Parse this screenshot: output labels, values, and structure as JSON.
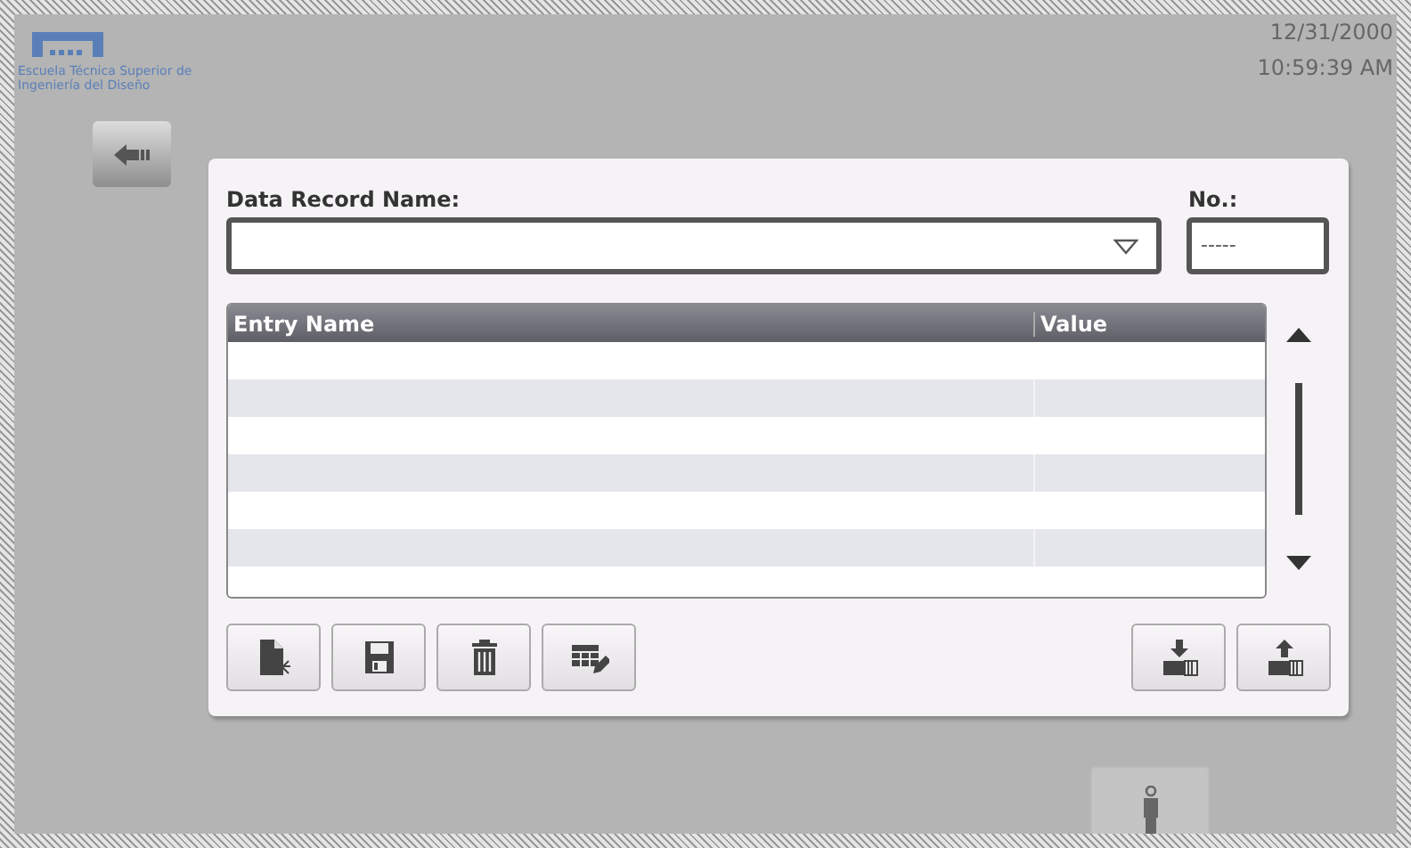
{
  "logo": {
    "caption": "Escuela Técnica Superior de Ingeniería del Diseño"
  },
  "clock": {
    "date": "12/31/2000",
    "time": "10:59:39 AM"
  },
  "recipe": {
    "name_label": "Data Record Name:",
    "number_label": "No.:",
    "number_value": "-----",
    "table": {
      "columns": [
        "Entry Name",
        "Value"
      ]
    }
  },
  "toolbar_left": [
    {
      "kind": "new"
    },
    {
      "kind": "save"
    },
    {
      "kind": "delete"
    },
    {
      "kind": "edit"
    }
  ],
  "toolbar_right": [
    {
      "kind": "import"
    },
    {
      "kind": "export"
    }
  ]
}
